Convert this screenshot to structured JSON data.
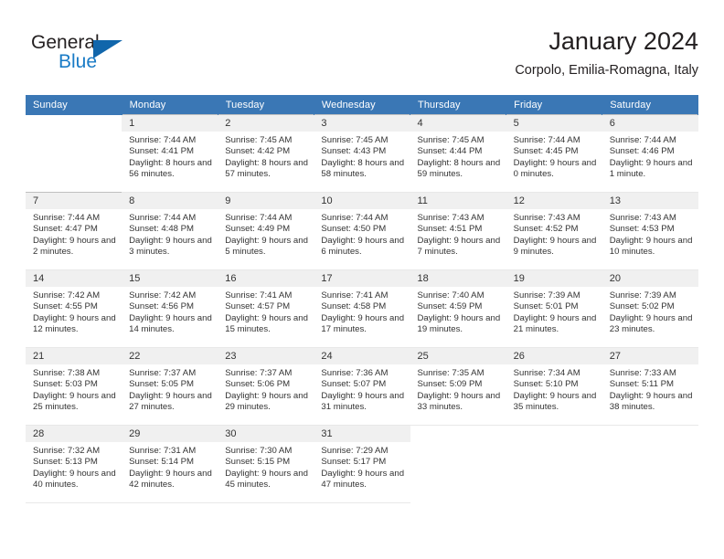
{
  "brand": {
    "name_part1": "General",
    "name_part2": "Blue",
    "triangle_icon": "triangle-icon",
    "accent_color": "#1166ab",
    "text_color": "#231f20"
  },
  "header": {
    "title": "January 2024",
    "subtitle": "Corpolo, Emilia-Romagna, Italy"
  },
  "calendar": {
    "header_bg": "#3a77b5",
    "daynum_bg": "#f0f0f0",
    "weekday_headers": [
      "Sunday",
      "Monday",
      "Tuesday",
      "Wednesday",
      "Thursday",
      "Friday",
      "Saturday"
    ],
    "weeks": [
      [
        {
          "day": "",
          "sunrise": "",
          "sunset": "",
          "daylight": "",
          "empty": true
        },
        {
          "day": "1",
          "sunrise": "Sunrise: 7:44 AM",
          "sunset": "Sunset: 4:41 PM",
          "daylight": "Daylight: 8 hours and 56 minutes."
        },
        {
          "day": "2",
          "sunrise": "Sunrise: 7:45 AM",
          "sunset": "Sunset: 4:42 PM",
          "daylight": "Daylight: 8 hours and 57 minutes."
        },
        {
          "day": "3",
          "sunrise": "Sunrise: 7:45 AM",
          "sunset": "Sunset: 4:43 PM",
          "daylight": "Daylight: 8 hours and 58 minutes."
        },
        {
          "day": "4",
          "sunrise": "Sunrise: 7:45 AM",
          "sunset": "Sunset: 4:44 PM",
          "daylight": "Daylight: 8 hours and 59 minutes."
        },
        {
          "day": "5",
          "sunrise": "Sunrise: 7:44 AM",
          "sunset": "Sunset: 4:45 PM",
          "daylight": "Daylight: 9 hours and 0 minutes."
        },
        {
          "day": "6",
          "sunrise": "Sunrise: 7:44 AM",
          "sunset": "Sunset: 4:46 PM",
          "daylight": "Daylight: 9 hours and 1 minute."
        }
      ],
      [
        {
          "day": "7",
          "sunrise": "Sunrise: 7:44 AM",
          "sunset": "Sunset: 4:47 PM",
          "daylight": "Daylight: 9 hours and 2 minutes."
        },
        {
          "day": "8",
          "sunrise": "Sunrise: 7:44 AM",
          "sunset": "Sunset: 4:48 PM",
          "daylight": "Daylight: 9 hours and 3 minutes."
        },
        {
          "day": "9",
          "sunrise": "Sunrise: 7:44 AM",
          "sunset": "Sunset: 4:49 PM",
          "daylight": "Daylight: 9 hours and 5 minutes."
        },
        {
          "day": "10",
          "sunrise": "Sunrise: 7:44 AM",
          "sunset": "Sunset: 4:50 PM",
          "daylight": "Daylight: 9 hours and 6 minutes."
        },
        {
          "day": "11",
          "sunrise": "Sunrise: 7:43 AM",
          "sunset": "Sunset: 4:51 PM",
          "daylight": "Daylight: 9 hours and 7 minutes."
        },
        {
          "day": "12",
          "sunrise": "Sunrise: 7:43 AM",
          "sunset": "Sunset: 4:52 PM",
          "daylight": "Daylight: 9 hours and 9 minutes."
        },
        {
          "day": "13",
          "sunrise": "Sunrise: 7:43 AM",
          "sunset": "Sunset: 4:53 PM",
          "daylight": "Daylight: 9 hours and 10 minutes."
        }
      ],
      [
        {
          "day": "14",
          "sunrise": "Sunrise: 7:42 AM",
          "sunset": "Sunset: 4:55 PM",
          "daylight": "Daylight: 9 hours and 12 minutes."
        },
        {
          "day": "15",
          "sunrise": "Sunrise: 7:42 AM",
          "sunset": "Sunset: 4:56 PM",
          "daylight": "Daylight: 9 hours and 14 minutes."
        },
        {
          "day": "16",
          "sunrise": "Sunrise: 7:41 AM",
          "sunset": "Sunset: 4:57 PM",
          "daylight": "Daylight: 9 hours and 15 minutes."
        },
        {
          "day": "17",
          "sunrise": "Sunrise: 7:41 AM",
          "sunset": "Sunset: 4:58 PM",
          "daylight": "Daylight: 9 hours and 17 minutes."
        },
        {
          "day": "18",
          "sunrise": "Sunrise: 7:40 AM",
          "sunset": "Sunset: 4:59 PM",
          "daylight": "Daylight: 9 hours and 19 minutes."
        },
        {
          "day": "19",
          "sunrise": "Sunrise: 7:39 AM",
          "sunset": "Sunset: 5:01 PM",
          "daylight": "Daylight: 9 hours and 21 minutes."
        },
        {
          "day": "20",
          "sunrise": "Sunrise: 7:39 AM",
          "sunset": "Sunset: 5:02 PM",
          "daylight": "Daylight: 9 hours and 23 minutes."
        }
      ],
      [
        {
          "day": "21",
          "sunrise": "Sunrise: 7:38 AM",
          "sunset": "Sunset: 5:03 PM",
          "daylight": "Daylight: 9 hours and 25 minutes."
        },
        {
          "day": "22",
          "sunrise": "Sunrise: 7:37 AM",
          "sunset": "Sunset: 5:05 PM",
          "daylight": "Daylight: 9 hours and 27 minutes."
        },
        {
          "day": "23",
          "sunrise": "Sunrise: 7:37 AM",
          "sunset": "Sunset: 5:06 PM",
          "daylight": "Daylight: 9 hours and 29 minutes."
        },
        {
          "day": "24",
          "sunrise": "Sunrise: 7:36 AM",
          "sunset": "Sunset: 5:07 PM",
          "daylight": "Daylight: 9 hours and 31 minutes."
        },
        {
          "day": "25",
          "sunrise": "Sunrise: 7:35 AM",
          "sunset": "Sunset: 5:09 PM",
          "daylight": "Daylight: 9 hours and 33 minutes."
        },
        {
          "day": "26",
          "sunrise": "Sunrise: 7:34 AM",
          "sunset": "Sunset: 5:10 PM",
          "daylight": "Daylight: 9 hours and 35 minutes."
        },
        {
          "day": "27",
          "sunrise": "Sunrise: 7:33 AM",
          "sunset": "Sunset: 5:11 PM",
          "daylight": "Daylight: 9 hours and 38 minutes."
        }
      ],
      [
        {
          "day": "28",
          "sunrise": "Sunrise: 7:32 AM",
          "sunset": "Sunset: 5:13 PM",
          "daylight": "Daylight: 9 hours and 40 minutes."
        },
        {
          "day": "29",
          "sunrise": "Sunrise: 7:31 AM",
          "sunset": "Sunset: 5:14 PM",
          "daylight": "Daylight: 9 hours and 42 minutes."
        },
        {
          "day": "30",
          "sunrise": "Sunrise: 7:30 AM",
          "sunset": "Sunset: 5:15 PM",
          "daylight": "Daylight: 9 hours and 45 minutes."
        },
        {
          "day": "31",
          "sunrise": "Sunrise: 7:29 AM",
          "sunset": "Sunset: 5:17 PM",
          "daylight": "Daylight: 9 hours and 47 minutes."
        },
        {
          "day": "",
          "sunrise": "",
          "sunset": "",
          "daylight": "",
          "empty": true
        },
        {
          "day": "",
          "sunrise": "",
          "sunset": "",
          "daylight": "",
          "empty": true
        },
        {
          "day": "",
          "sunrise": "",
          "sunset": "",
          "daylight": "",
          "empty": true
        }
      ]
    ]
  }
}
